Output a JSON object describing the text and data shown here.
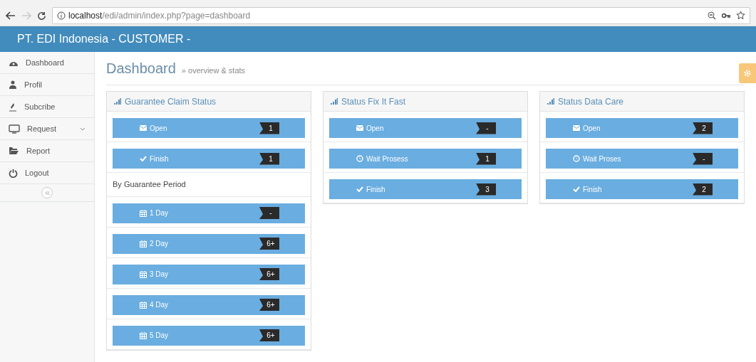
{
  "browser": {
    "url_host": "localhost",
    "url_path": "/edi/admin/index.php?page=dashboard"
  },
  "header": {
    "title": "PT. EDI Indonesia - CUSTOMER -"
  },
  "sidebar": {
    "items": [
      {
        "label": "Dashboard",
        "kind": "link"
      },
      {
        "label": "Profil",
        "kind": "link"
      },
      {
        "label": "Subcribe",
        "kind": "link"
      },
      {
        "label": "Request",
        "kind": "submenu"
      },
      {
        "label": "Report",
        "kind": "link"
      },
      {
        "label": "Logout",
        "kind": "link"
      }
    ]
  },
  "page": {
    "title": "Dashboard",
    "subtitle": "» overview & stats"
  },
  "panels": [
    {
      "title": "Guarantee Claim Status",
      "items": [
        {
          "kind": "open",
          "label": "Open",
          "count": "1"
        },
        {
          "kind": "finish",
          "label": "Finish",
          "count": "1"
        },
        {
          "kind": "heading",
          "label": "By Guarantee Period"
        },
        {
          "kind": "period",
          "label": "1 Day",
          "count": "-"
        },
        {
          "kind": "period",
          "label": "2 Day",
          "count": "6+"
        },
        {
          "kind": "period",
          "label": "3 Day",
          "count": "6+"
        },
        {
          "kind": "period",
          "label": "4 Day",
          "count": "6+"
        },
        {
          "kind": "period",
          "label": "5 Day",
          "count": "6+"
        }
      ]
    },
    {
      "title": "Status Fix It Fast",
      "items": [
        {
          "kind": "open",
          "label": "Open",
          "count": "-"
        },
        {
          "kind": "waiting",
          "label": "Wait Prosess",
          "count": "1"
        },
        {
          "kind": "finish",
          "label": "Finish",
          "count": "3"
        }
      ]
    },
    {
      "title": "Status Data Care",
      "items": [
        {
          "kind": "open",
          "label": "Open",
          "count": "2"
        },
        {
          "kind": "waiting",
          "label": "Wait Proses",
          "count": "-"
        },
        {
          "kind": "finish",
          "label": "Finish",
          "count": "2"
        }
      ]
    }
  ]
}
